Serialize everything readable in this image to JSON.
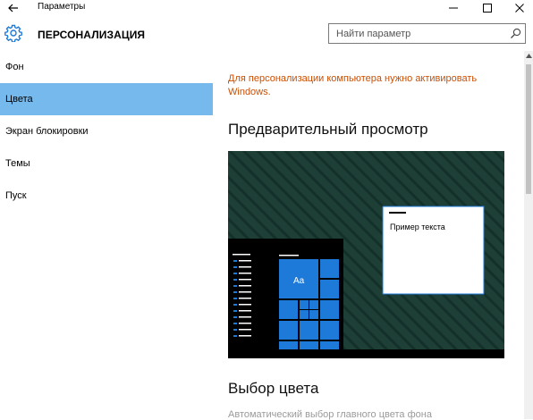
{
  "window": {
    "title": "Параметры"
  },
  "header": {
    "title": "ПЕРСОНАЛИЗАЦИЯ",
    "search_placeholder": "Найти параметр"
  },
  "sidebar": {
    "items": [
      {
        "label": "Фон",
        "selected": false
      },
      {
        "label": "Цвета",
        "selected": true
      },
      {
        "label": "Экран блокировки",
        "selected": false
      },
      {
        "label": "Темы",
        "selected": false
      },
      {
        "label": "Пуск",
        "selected": false
      }
    ]
  },
  "main": {
    "activation_warning": "Для персонализации компьютера нужно активировать Windows.",
    "preview_heading": "Предварительный просмотр",
    "preview_sample_text": "Пример текста",
    "tile_label": "Aa",
    "color_heading": "Выбор цвета",
    "auto_color_text": "Автоматический выбор главного цвета фона"
  },
  "colors": {
    "accent": "#1e7ad8",
    "selection": "#76b9ed",
    "warning": "#cc4e00",
    "preview_background": "#1c3c34",
    "start_menu": "#000000"
  },
  "icons": {
    "back": "back-arrow-icon",
    "settings": "gear-icon",
    "search": "search-icon",
    "minimize": "minimize-icon",
    "maximize": "maximize-icon",
    "close": "close-icon"
  }
}
